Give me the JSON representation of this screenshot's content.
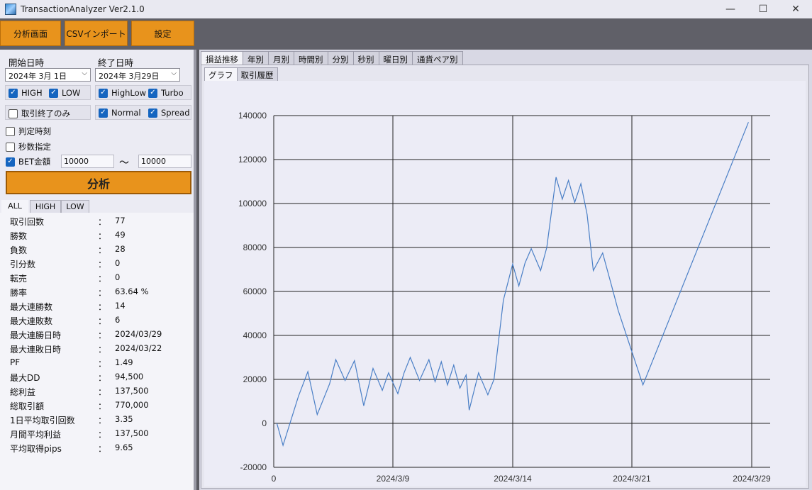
{
  "window": {
    "title": "TransactionAnalyzer Ver2.1.0",
    "minimize": "—",
    "maximize": "☐",
    "close": "✕"
  },
  "toolbar": {
    "analysis_screen": "分析画面",
    "csv_import": "CSVインポート",
    "settings": "設定"
  },
  "filters": {
    "start_label": "開始日時",
    "end_label": "終了日時",
    "start_date": "2024年  3月  1日",
    "end_date": "2024年  3月29日",
    "high": {
      "label": "HIGH",
      "checked": true
    },
    "low": {
      "label": "LOW",
      "checked": true
    },
    "highlow": {
      "label": "HighLow",
      "checked": true
    },
    "turbo": {
      "label": "Turbo",
      "checked": true
    },
    "closed_only": {
      "label": "取引終了のみ",
      "checked": false
    },
    "normal": {
      "label": "Normal",
      "checked": true
    },
    "spread": {
      "label": "Spread",
      "checked": true
    },
    "judge_time": {
      "label": "判定時刻",
      "checked": false
    },
    "seconds": {
      "label": "秒数指定",
      "checked": false
    },
    "bet": {
      "label": "BET金額",
      "checked": true,
      "min": "10000",
      "max": "10000",
      "tilde": "〜"
    }
  },
  "analyze_button": "分析",
  "stat_tabs": [
    "ALL",
    "HIGH",
    "LOW"
  ],
  "stats": [
    {
      "key": "取引回数",
      "value": "77"
    },
    {
      "key": "勝数",
      "value": "49"
    },
    {
      "key": "負数",
      "value": "28"
    },
    {
      "key": "引分数",
      "value": "0"
    },
    {
      "key": "転売",
      "value": "0"
    },
    {
      "key": "勝率",
      "value": "63.64 %"
    },
    {
      "key": "最大連勝数",
      "value": "14"
    },
    {
      "key": "最大連敗数",
      "value": "6"
    },
    {
      "key": "最大連勝日時",
      "value": "2024/03/29"
    },
    {
      "key": "最大連敗日時",
      "value": "2024/03/22"
    },
    {
      "key": "PF",
      "value": "1.49"
    },
    {
      "key": "最大DD",
      "value": "94,500"
    },
    {
      "key": "総利益",
      "value": "137,500"
    },
    {
      "key": "総取引額",
      "value": "770,000"
    },
    {
      "key": "1日平均取引回数",
      "value": "3.35"
    },
    {
      "key": "月間平均利益",
      "value": "137,500"
    },
    {
      "key": "平均取得pips",
      "value": "9.65"
    }
  ],
  "stat_colon": "：",
  "main_tabs": [
    "損益推移",
    "年別",
    "月別",
    "時間別",
    "分別",
    "秒別",
    "曜日別",
    "通貨ペア別"
  ],
  "sub_tabs": [
    "グラフ",
    "取引履歴"
  ],
  "chart_data": {
    "type": "line",
    "title": "",
    "xlabel": "",
    "ylabel": "",
    "x_ticks": [
      "0",
      "2024/3/9",
      "2024/3/14",
      "2024/3/21",
      "2024/3/29"
    ],
    "y_ticks": [
      "-20000",
      "0",
      "20000",
      "40000",
      "60000",
      "80000",
      "100000",
      "120000",
      "140000"
    ],
    "ylim": [
      -20000,
      140000
    ],
    "xlim": [
      0,
      80
    ],
    "grid": true,
    "line_color": "#4a7fc6",
    "series": [
      {
        "x": [
          0.5,
          1.5,
          4,
          5.5,
          7,
          9,
          10,
          11.5,
          13,
          14.5,
          16,
          17.5,
          18.5,
          20,
          21,
          22,
          23.5,
          25,
          26,
          27,
          28,
          29,
          30,
          31,
          31.5,
          33,
          34.5,
          35.5,
          37,
          38.5,
          39.5,
          40.5,
          41.5,
          43,
          44,
          45.5,
          46.5,
          47.5,
          48.5,
          49.5,
          50.5,
          51.5,
          53,
          54.5,
          55.5,
          59.5,
          76.5
        ],
        "y": [
          0,
          -10000,
          12500,
          23500,
          4000,
          18000,
          29000,
          19500,
          28500,
          8000,
          25000,
          15000,
          23000,
          13500,
          23000,
          30000,
          19500,
          29000,
          19000,
          28000,
          17500,
          26500,
          16000,
          22000,
          6000,
          23000,
          13000,
          20000,
          56000,
          72500,
          62500,
          73000,
          79500,
          69500,
          80000,
          112000,
          102000,
          110500,
          100500,
          109000,
          95000,
          69500,
          77500,
          62000,
          51500,
          17500,
          137000
        ]
      }
    ]
  }
}
